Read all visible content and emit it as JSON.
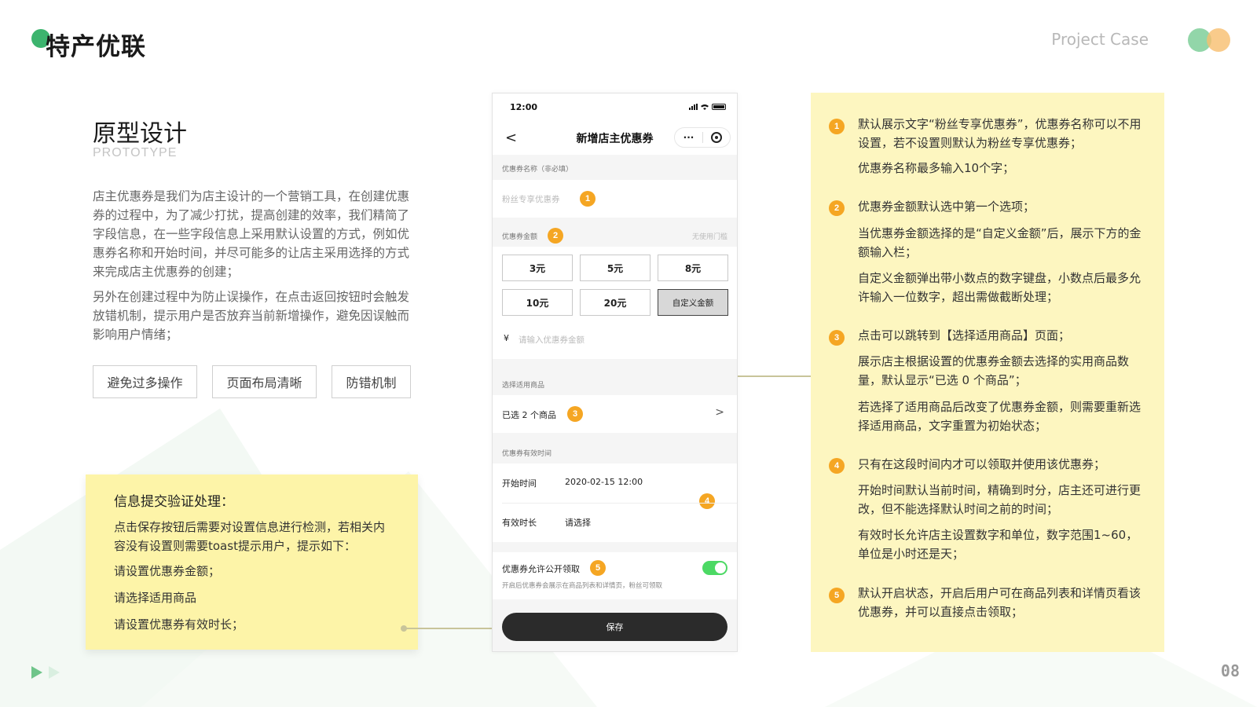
{
  "header": {
    "brand": "特产优联",
    "project_case": "Project Case"
  },
  "section": {
    "title": "原型设计",
    "subtitle": "PROTOTYPE",
    "para1": "店主优惠券是我们为店主设计的一个营销工具，在创建优惠券的过程中，为了减少打扰，提高创建的效率，我们精简了字段信息，在一些字段信息上采用默认设置的方式，例如优惠券名称和开始时间，并尽可能多的让店主采用选择的方式来完成店主优惠券的创建；",
    "para2": "另外在创建过程中为防止误操作，在点击返回按钮时会触发放错机制，提示用户是否放弃当前新增操作，避免因误触而影响用户情绪；",
    "tags": [
      "避免过多操作",
      "页面布局清晰",
      "防错机制"
    ]
  },
  "note_left": {
    "title": "信息提交验证处理：",
    "desc": "点击保存按钮后需要对设置信息进行检测，若相关内容没有设置则需要toast提示用户，提示如下：",
    "items": [
      "请设置优惠券金额；",
      "请选择适用商品",
      "请设置优惠券有效时长；"
    ]
  },
  "phone": {
    "time": "12:00",
    "nav_title": "新增店主优惠券",
    "back": "<",
    "more": "···",
    "name_label": "优惠券名称（非必填）",
    "name_placeholder": "粉丝专享优惠券",
    "amount_label": "优惠券金额",
    "amount_hint": "无使用门槛",
    "amounts": [
      "3元",
      "5元",
      "8元",
      "10元",
      "20元",
      "自定义金额"
    ],
    "currency": "¥",
    "amount_placeholder": "请输入优惠券金额",
    "goods_label": "选择适用商品",
    "goods_value": "已选 2 个商品",
    "chevron": ">",
    "validity_label": "优惠券有效时间",
    "start_label": "开始时间",
    "start_value": "2020-02-15 12:00",
    "duration_label": "有效时长",
    "duration_value": "请选择",
    "public_label": "优惠券允许公开领取",
    "public_desc": "开启后优惠券会展示在商品列表和详情页，粉丝可领取",
    "public_enabled": true,
    "save": "保存"
  },
  "badges": [
    "1",
    "2",
    "3",
    "4",
    "5"
  ],
  "note_right": {
    "p1a": "默认展示文字“粉丝专享优惠券”，优惠券名称可以不用设置，若不设置则默认为粉丝专享优惠券；",
    "p1b": "优惠券名称最多输入10个字；",
    "p2a": "优惠券金额默认选中第一个选项；",
    "p2b": "当优惠券金额选择的是“自定义金额”后，展示下方的金额输入栏；",
    "p2c": "自定义金额弹出带小数点的数字键盘，小数点后最多允许输入一位数字，超出需做截断处理；",
    "p3a": "点击可以跳转到【选择适用商品】页面；",
    "p3b": "展示店主根据设置的优惠券金额去选择的实用商品数量，默认显示“已选 0 个商品”；",
    "p3c": "若选择了适用商品后改变了优惠券金额，则需要重新选择适用商品，文字重置为初始状态；",
    "p4a": "只有在这段时间内才可以领取并使用该优惠券；",
    "p4b": "开始时间默认当前时间，精确到时分，店主还可进行更改，但不能选择默认时间之前的时间；",
    "p4c": "有效时长允许店主设置数字和单位，数字范围1~60，单位是小时还是天；",
    "p5a": "默认开启状态，开启后用户可在商品列表和详情页看该优惠券，并可以直接点击领取；"
  },
  "footer": {
    "page": "08"
  },
  "colors": {
    "accent_green": "#3cb46e",
    "badge_orange": "#f5a623",
    "note_yellow": "#fdf4a8",
    "connector": "#c8c49a"
  }
}
